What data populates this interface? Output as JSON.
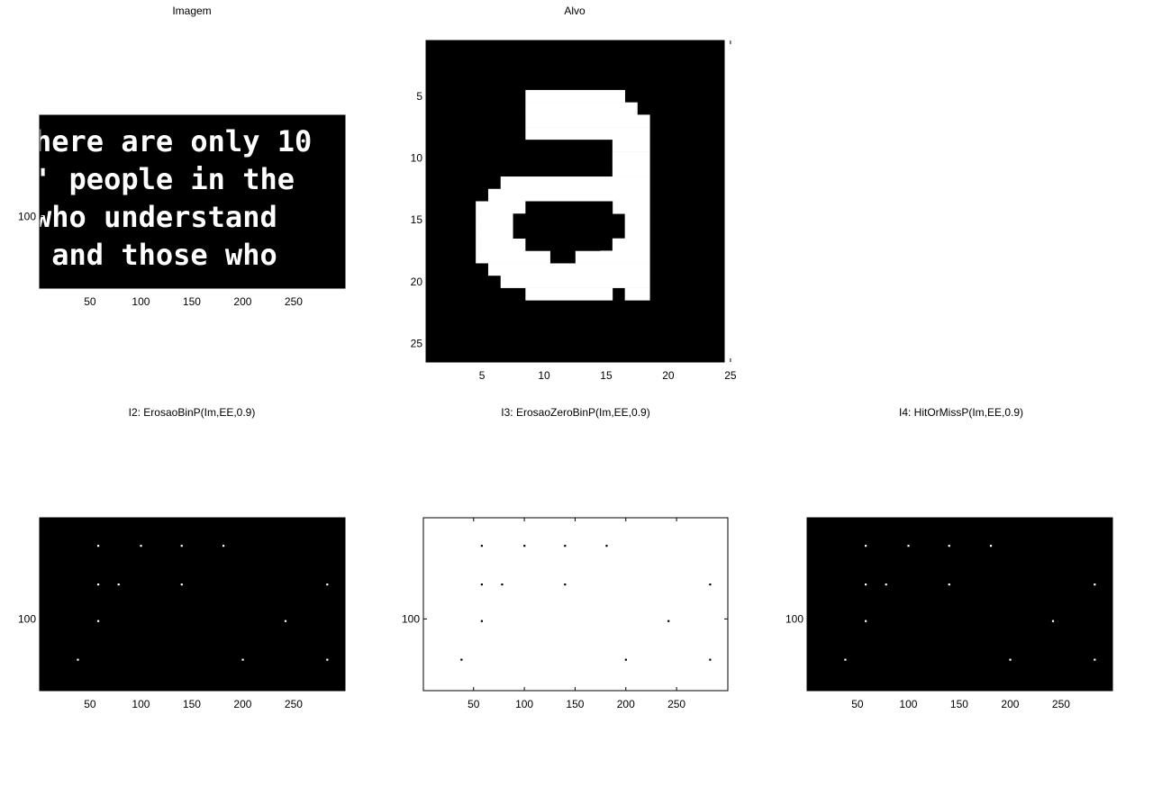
{
  "figure": {
    "background": "#ffffff"
  },
  "chart_data": [
    {
      "type": "heatmap",
      "id": "imagem",
      "title": "Imagem",
      "xlim": [
        0.5,
        300.5
      ],
      "ylim": [
        0.5,
        170.5
      ],
      "xticks": [
        50,
        100,
        150,
        200,
        250
      ],
      "yticks": [
        100
      ],
      "grid": false,
      "colormap": "gray",
      "background": "#000000",
      "foreground": "#ffffff",
      "text_lines": [
        "here are only 10",
        "' people in the",
        "who understand",
        " and those who"
      ]
    },
    {
      "type": "heatmap",
      "id": "alvo",
      "title": "Alvo",
      "xlim": [
        0.5,
        24.5
      ],
      "ylim": [
        0.5,
        26.5
      ],
      "xticks": [
        5,
        10,
        15,
        20,
        25
      ],
      "yticks": [
        5,
        10,
        15,
        20,
        25
      ],
      "grid": false,
      "colormap": "gray",
      "background": "#000000",
      "foreground": "#ffffff",
      "white_runs": [
        {
          "row": 5,
          "cols": [
            9,
            16
          ]
        },
        {
          "row": 6,
          "cols": [
            9,
            17
          ]
        },
        {
          "row": 7,
          "cols": [
            9,
            18
          ]
        },
        {
          "row": 8,
          "cols": [
            9,
            18
          ]
        },
        {
          "row": 9,
          "cols": [
            16,
            18
          ]
        },
        {
          "row": 10,
          "cols": [
            16,
            18
          ]
        },
        {
          "row": 11,
          "cols": [
            16,
            18
          ]
        },
        {
          "row": 12,
          "cols": [
            7,
            18
          ]
        },
        {
          "row": 13,
          "cols": [
            6,
            18
          ]
        },
        {
          "row": 14,
          "cols": [
            5,
            18
          ]
        },
        {
          "row": 15,
          "cols": [
            5,
            8
          ]
        },
        {
          "row": 15,
          "cols": [
            17,
            18
          ]
        },
        {
          "row": 16,
          "cols": [
            5,
            8
          ]
        },
        {
          "row": 16,
          "cols": [
            17,
            18
          ]
        },
        {
          "row": 17,
          "cols": [
            5,
            8
          ]
        },
        {
          "row": 17,
          "cols": [
            16,
            18
          ]
        },
        {
          "row": 18,
          "cols": [
            5,
            10
          ]
        },
        {
          "row": 18,
          "cols": [
            13,
            18
          ]
        },
        {
          "row": 19,
          "cols": [
            6,
            18
          ]
        },
        {
          "row": 20,
          "cols": [
            7,
            18
          ]
        },
        {
          "row": 21,
          "cols": [
            9,
            15
          ]
        },
        {
          "row": 21,
          "cols": [
            17,
            18
          ]
        }
      ],
      "black_runs": [
        {
          "row": 14,
          "cols": [
            9,
            15
          ]
        },
        {
          "row": 15,
          "cols": [
            8,
            15
          ]
        },
        {
          "row": 16,
          "cols": [
            8,
            15
          ]
        },
        {
          "row": 17,
          "cols": [
            9,
            14
          ]
        },
        {
          "row": 18,
          "cols": [
            11,
            12
          ]
        }
      ]
    },
    {
      "type": "heatmap",
      "id": "i2",
      "title": "I2: ErosaoBinP(Im,EE,0.9)",
      "xlim": [
        0.5,
        300.5
      ],
      "ylim": [
        0.5,
        170.5
      ],
      "xticks": [
        50,
        100,
        150,
        200,
        250
      ],
      "yticks": [
        100
      ],
      "grid": false,
      "colormap": "gray",
      "background": "#000000",
      "foreground": "#ffffff",
      "points": [
        [
          58,
          28
        ],
        [
          100,
          28
        ],
        [
          140,
          28
        ],
        [
          181,
          28
        ],
        [
          58,
          66
        ],
        [
          78,
          66
        ],
        [
          140,
          66
        ],
        [
          283,
          66
        ],
        [
          58,
          102
        ],
        [
          242,
          102
        ],
        [
          38,
          140
        ],
        [
          200,
          140
        ],
        [
          283,
          140
        ]
      ]
    },
    {
      "type": "heatmap",
      "id": "i3",
      "title": "I3: ErosaoZeroBinP(Im,EE,0.9)",
      "xlim": [
        0.5,
        300.5
      ],
      "ylim": [
        0.5,
        170.5
      ],
      "xticks": [
        50,
        100,
        150,
        200,
        250
      ],
      "yticks": [
        100
      ],
      "grid": false,
      "colormap": "gray",
      "background": "#ffffff",
      "foreground": "#000000",
      "points": [
        [
          58,
          28
        ],
        [
          100,
          28
        ],
        [
          140,
          28
        ],
        [
          181,
          28
        ],
        [
          58,
          66
        ],
        [
          78,
          66
        ],
        [
          140,
          66
        ],
        [
          283,
          66
        ],
        [
          58,
          102
        ],
        [
          242,
          102
        ],
        [
          38,
          140
        ],
        [
          200,
          140
        ],
        [
          283,
          140
        ]
      ]
    },
    {
      "type": "heatmap",
      "id": "i4",
      "title": "I4: HitOrMissP(Im,EE,0.9)",
      "xlim": [
        0.5,
        300.5
      ],
      "ylim": [
        0.5,
        170.5
      ],
      "xticks": [
        50,
        100,
        150,
        200,
        250
      ],
      "yticks": [
        100
      ],
      "grid": false,
      "colormap": "gray",
      "background": "#000000",
      "foreground": "#ffffff",
      "points": [
        [
          58,
          28
        ],
        [
          100,
          28
        ],
        [
          140,
          28
        ],
        [
          181,
          28
        ],
        [
          58,
          66
        ],
        [
          78,
          66
        ],
        [
          140,
          66
        ],
        [
          283,
          66
        ],
        [
          58,
          102
        ],
        [
          242,
          102
        ],
        [
          38,
          140
        ],
        [
          200,
          140
        ],
        [
          283,
          140
        ]
      ]
    }
  ]
}
